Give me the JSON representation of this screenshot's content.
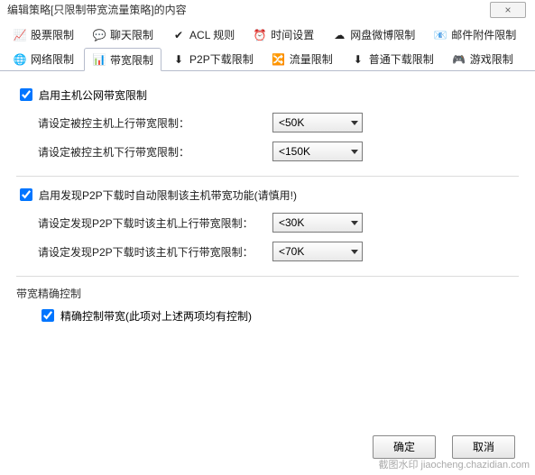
{
  "window": {
    "title": "编辑策略[只限制带宽流量策略]的内容",
    "close_label": "×"
  },
  "tabs_row1": [
    {
      "icon": "📈",
      "label": "股票限制"
    },
    {
      "icon": "💬",
      "label": "聊天限制"
    },
    {
      "icon": "✔",
      "label": "ACL 规则"
    },
    {
      "icon": "⏰",
      "label": "时间设置"
    },
    {
      "icon": "☁",
      "label": "网盘微博限制"
    },
    {
      "icon": "📧",
      "label": "邮件附件限制"
    }
  ],
  "tabs_row2": [
    {
      "icon": "🌐",
      "label": "网络限制"
    },
    {
      "icon": "📊",
      "label": "带宽限制",
      "active": true
    },
    {
      "icon": "⬇",
      "label": "P2P下载限制"
    },
    {
      "icon": "🔀",
      "label": "流量限制"
    },
    {
      "icon": "⬇",
      "label": "普通下载限制"
    },
    {
      "icon": "🎮",
      "label": "游戏限制"
    }
  ],
  "section1": {
    "checkbox_label": "启用主机公网带宽限制",
    "checked": true,
    "up_label": "请设定被控主机上行带宽限制：",
    "up_value": "<50K",
    "down_label": "请设定被控主机下行带宽限制：",
    "down_value": "<150K"
  },
  "section2": {
    "checkbox_label": "启用发现P2P下载时自动限制该主机带宽功能(请慎用!)",
    "checked": true,
    "up_label": "请设定发现P2P下载时该主机上行带宽限制：",
    "up_value": "<30K",
    "down_label": "请设定发现P2P下载时该主机下行带宽限制：",
    "down_value": "<70K"
  },
  "section3": {
    "group_label": "带宽精确控制",
    "checkbox_label": "精确控制带宽(此项对上述两项均有控制)",
    "checked": true
  },
  "buttons": {
    "ok": "确定",
    "cancel": "取消"
  },
  "watermark": "截图水印 jiaocheng.chazidian.com"
}
